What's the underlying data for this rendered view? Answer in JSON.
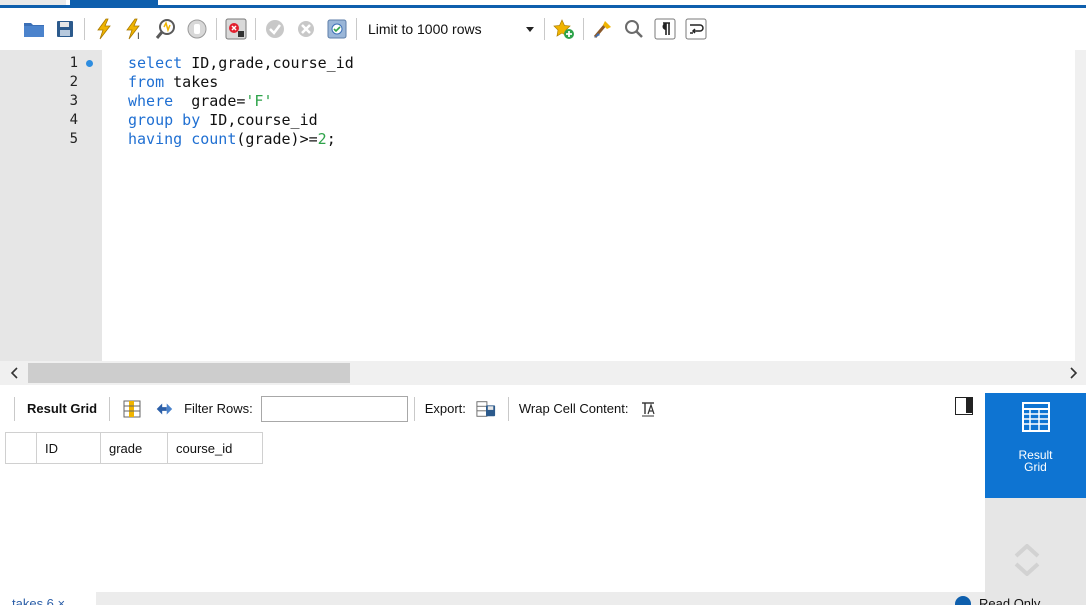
{
  "toolbar": {
    "limit_label": "Limit to 1000 rows",
    "icons": [
      "open-folder-icon",
      "save-icon",
      "execute-icon",
      "execute-current-icon",
      "explain-icon",
      "stop-icon",
      "toggle-error-icon",
      "commit-icon",
      "rollback-icon",
      "autocommit-icon",
      "add-snippet-icon",
      "beautify-icon",
      "find-icon",
      "invisible-chars-icon",
      "wrap-icon"
    ]
  },
  "editor": {
    "line_numbers": [
      "1",
      "2",
      "3",
      "4",
      "5"
    ],
    "lines": [
      [
        {
          "t": "select",
          "c": "kw"
        },
        {
          "t": " ID,grade,course_id",
          "c": ""
        }
      ],
      [
        {
          "t": "from",
          "c": "kw"
        },
        {
          "t": " takes",
          "c": ""
        }
      ],
      [
        {
          "t": "where",
          "c": "kw"
        },
        {
          "t": "  grade=",
          "c": ""
        },
        {
          "t": "'F'",
          "c": "str"
        }
      ],
      [
        {
          "t": "group by",
          "c": "kw"
        },
        {
          "t": " ID,course_id",
          "c": ""
        }
      ],
      [
        {
          "t": "having",
          "c": "kw"
        },
        {
          "t": " ",
          "c": ""
        },
        {
          "t": "count",
          "c": "kw"
        },
        {
          "t": "(grade)>=",
          "c": ""
        },
        {
          "t": "2",
          "c": "num"
        },
        {
          "t": ";",
          "c": ""
        }
      ]
    ]
  },
  "result": {
    "title": "Result Grid",
    "filter_label": "Filter Rows:",
    "filter_value": "",
    "export_label": "Export:",
    "wrap_label": "Wrap Cell Content:",
    "columns": [
      "ID",
      "grade",
      "course_id"
    ]
  },
  "side_panel": {
    "active_label_line1": "Result",
    "active_label_line2": "Grid"
  },
  "status": {
    "tab_label": "takes 6",
    "readonly_label": "Read Only"
  },
  "colors": {
    "accent": "#0e74d2",
    "keyword": "#1f6fd2",
    "string": "#2ea34a"
  }
}
